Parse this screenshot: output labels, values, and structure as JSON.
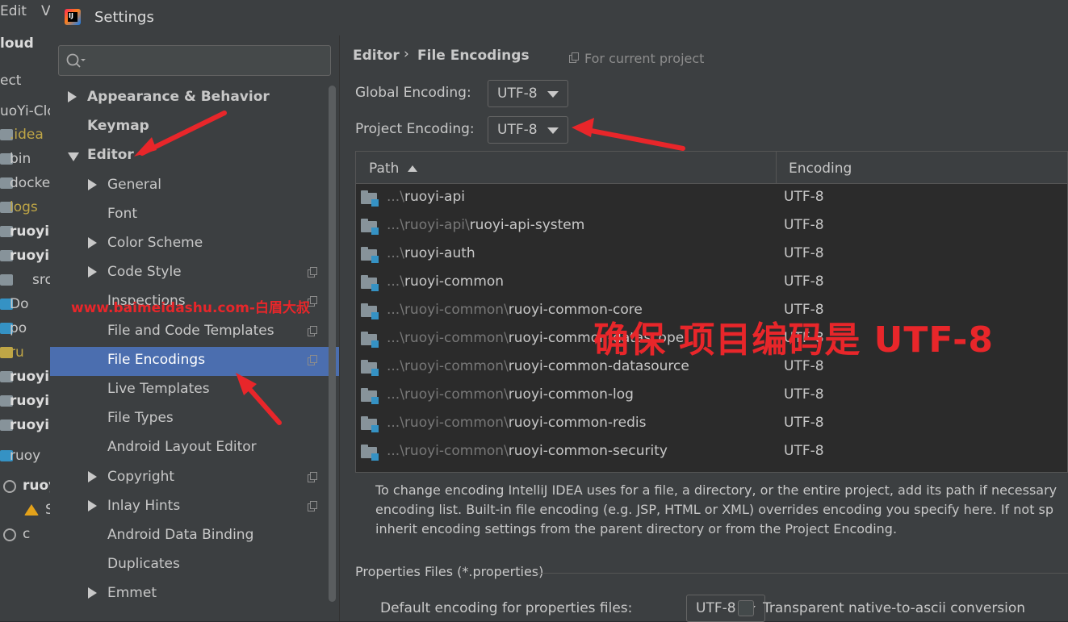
{
  "background_ide": {
    "menu": [
      "Edit",
      "V"
    ],
    "rows": [
      {
        "text": "loud",
        "color": "#dcdcdc",
        "bold": true,
        "icon": null
      },
      {
        "text": "ect",
        "color": "#c8c8c8",
        "bold": false,
        "icon": null
      },
      {
        "text": "uoYi-Clo",
        "color": "#c8c8c8",
        "bold": false,
        "icon": null
      },
      {
        "text": ".idea",
        "color": "#bfa646",
        "bold": false,
        "icon": "folder-icon"
      },
      {
        "text": "bin",
        "color": "#c8c8c8",
        "bold": false,
        "icon": "folder-icon"
      },
      {
        "text": "docke",
        "color": "#c8c8c8",
        "bold": false,
        "icon": "folder-icon"
      },
      {
        "text": "logs",
        "color": "#bfa646",
        "bold": false,
        "icon": "folder-icon"
      },
      {
        "text": "ruoyi-",
        "color": "#dcdcdc",
        "bold": true,
        "icon": "module-icon"
      },
      {
        "text": "ruoyi-",
        "color": "#dcdcdc",
        "bold": true,
        "icon": "module-icon"
      },
      {
        "text": "src",
        "color": "#c8c8c8",
        "bold": false,
        "icon": "folder-icon"
      },
      {
        "text": "Do",
        "color": "#c8c8c8",
        "bold": false,
        "icon": "docker-icon"
      },
      {
        "text": "po",
        "color": "#c8c8c8",
        "bold": false,
        "icon": "maven-icon"
      },
      {
        "text": "ru",
        "color": "#bfa646",
        "bold": false,
        "icon": "file-icon"
      },
      {
        "text": "ruoyi-",
        "color": "#dcdcdc",
        "bold": true,
        "icon": "module-icon"
      },
      {
        "text": "ruoyi-",
        "color": "#dcdcdc",
        "bold": true,
        "icon": "module-icon"
      },
      {
        "text": "ruoyi-",
        "color": "#dcdcdc",
        "bold": true,
        "icon": "module-icon"
      },
      {
        "text": "ruoy",
        "color": "#c8c8c8",
        "bold": false,
        "icon": "maven-icon"
      },
      {
        "text": "ruoy",
        "color": "#dcdcdc",
        "bold": true,
        "icon": "spinner-icon"
      },
      {
        "text": "S",
        "color": "#c8c8c8",
        "bold": false,
        "icon": "warning-icon"
      },
      {
        "text": "c",
        "color": "#c8c8c8",
        "bold": false,
        "icon": "spinner-icon"
      }
    ]
  },
  "dialog": {
    "title": "Settings",
    "search": {
      "placeholder": "",
      "value": ""
    },
    "tree": [
      {
        "label": "Appearance & Behavior",
        "level": 0,
        "arrow": "right",
        "bold": true,
        "selected": false,
        "project_icon": false
      },
      {
        "label": "Keymap",
        "level": 0,
        "arrow": null,
        "bold": true,
        "selected": false,
        "project_icon": false
      },
      {
        "label": "Editor",
        "level": 0,
        "arrow": "down",
        "bold": true,
        "selected": false,
        "project_icon": false
      },
      {
        "label": "General",
        "level": 1,
        "arrow": "right",
        "bold": false,
        "selected": false,
        "project_icon": false
      },
      {
        "label": "Font",
        "level": 1,
        "arrow": null,
        "bold": false,
        "selected": false,
        "project_icon": false
      },
      {
        "label": "Color Scheme",
        "level": 1,
        "arrow": "right",
        "bold": false,
        "selected": false,
        "project_icon": false
      },
      {
        "label": "Code Style",
        "level": 1,
        "arrow": "right",
        "bold": false,
        "selected": false,
        "project_icon": true
      },
      {
        "label": "Inspections",
        "level": 1,
        "arrow": null,
        "bold": false,
        "selected": false,
        "project_icon": true
      },
      {
        "label": "File and Code Templates",
        "level": 1,
        "arrow": null,
        "bold": false,
        "selected": false,
        "project_icon": true
      },
      {
        "label": "File Encodings",
        "level": 1,
        "arrow": null,
        "bold": false,
        "selected": true,
        "project_icon": true
      },
      {
        "label": "Live Templates",
        "level": 1,
        "arrow": null,
        "bold": false,
        "selected": false,
        "project_icon": false
      },
      {
        "label": "File Types",
        "level": 1,
        "arrow": null,
        "bold": false,
        "selected": false,
        "project_icon": false
      },
      {
        "label": "Android Layout Editor",
        "level": 1,
        "arrow": null,
        "bold": false,
        "selected": false,
        "project_icon": false
      },
      {
        "label": "Copyright",
        "level": 1,
        "arrow": "right",
        "bold": false,
        "selected": false,
        "project_icon": true
      },
      {
        "label": "Inlay Hints",
        "level": 1,
        "arrow": "right",
        "bold": false,
        "selected": false,
        "project_icon": true
      },
      {
        "label": "Android Data Binding",
        "level": 1,
        "arrow": null,
        "bold": false,
        "selected": false,
        "project_icon": false
      },
      {
        "label": "Duplicates",
        "level": 1,
        "arrow": null,
        "bold": false,
        "selected": false,
        "project_icon": false
      },
      {
        "label": "Emmet",
        "level": 1,
        "arrow": "right",
        "bold": false,
        "selected": false,
        "project_icon": false
      }
    ],
    "breadcrumb": {
      "parent": "Editor",
      "separator": "›",
      "current": "File Encodings"
    },
    "for_current_project": "For current project",
    "global_encoding": {
      "label": "Global Encoding:",
      "value": "UTF-8"
    },
    "project_encoding": {
      "label": "Project Encoding:",
      "value": "UTF-8"
    },
    "table": {
      "headers": {
        "path": "Path",
        "encoding": "Encoding"
      },
      "rows": [
        {
          "dim": "...\\",
          "main": "ruoyi-api",
          "encoding": "UTF-8"
        },
        {
          "dim": "...\\ruoyi-api\\",
          "main": "ruoyi-api-system",
          "encoding": "UTF-8"
        },
        {
          "dim": "...\\",
          "main": "ruoyi-auth",
          "encoding": "UTF-8"
        },
        {
          "dim": "...\\",
          "main": "ruoyi-common",
          "encoding": "UTF-8"
        },
        {
          "dim": "...\\ruoyi-common\\",
          "main": "ruoyi-common-core",
          "encoding": "UTF-8"
        },
        {
          "dim": "...\\ruoyi-common\\",
          "main": "ruoyi-common-datascope",
          "encoding": "UTF-8"
        },
        {
          "dim": "...\\ruoyi-common\\",
          "main": "ruoyi-common-datasource",
          "encoding": "UTF-8"
        },
        {
          "dim": "...\\ruoyi-common\\",
          "main": "ruoyi-common-log",
          "encoding": "UTF-8"
        },
        {
          "dim": "...\\ruoyi-common\\",
          "main": "ruoyi-common-redis",
          "encoding": "UTF-8"
        },
        {
          "dim": "...\\ruoyi-common\\",
          "main": "ruoyi-common-security",
          "encoding": "UTF-8"
        }
      ]
    },
    "info_lines": [
      "To change encoding IntelliJ IDEA uses for a file, a directory, or the entire project, add its path if necessary",
      "encoding list. Built-in file encoding (e.g. JSP, HTML or XML) overrides encoding you specify here. If not sp",
      "inherit encoding settings from the parent directory or from the Project Encoding."
    ],
    "properties": {
      "section_title": "Properties Files (*.properties)",
      "default_label": "Default encoding for properties files:",
      "default_value": "UTF-8",
      "transparent_label": "Transparent native-to-ascii conversion",
      "transparent_checked": false
    }
  },
  "annotation": {
    "text": "确保 项目编码是 UTF-8",
    "watermark": "www.baimeidashu.com-白眉大叔",
    "color": "#e8262a"
  }
}
